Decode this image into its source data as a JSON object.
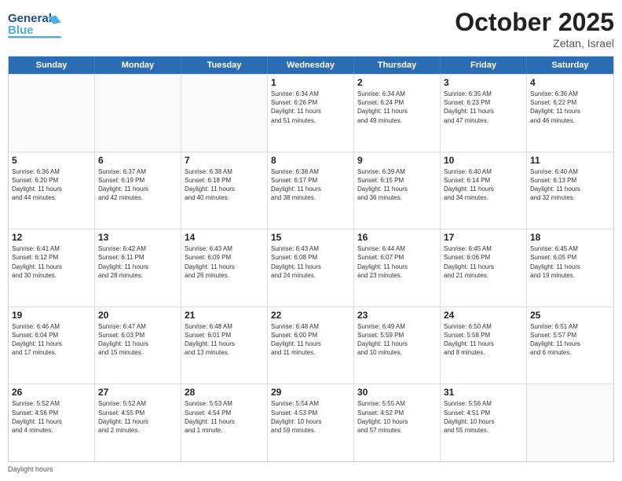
{
  "header": {
    "logo_general": "General",
    "logo_blue": "Blue",
    "month_title": "October 2025",
    "subtitle": "Zetan, Israel"
  },
  "days_of_week": [
    "Sunday",
    "Monday",
    "Tuesday",
    "Wednesday",
    "Thursday",
    "Friday",
    "Saturday"
  ],
  "footer_label": "Daylight hours",
  "weeks": [
    [
      {
        "day": "",
        "empty": true
      },
      {
        "day": "",
        "empty": true
      },
      {
        "day": "",
        "empty": true
      },
      {
        "day": "1",
        "lines": [
          "Sunrise: 6:34 AM",
          "Sunset: 6:26 PM",
          "Daylight: 11 hours",
          "and 51 minutes."
        ]
      },
      {
        "day": "2",
        "lines": [
          "Sunrise: 6:34 AM",
          "Sunset: 6:24 PM",
          "Daylight: 11 hours",
          "and 49 minutes."
        ]
      },
      {
        "day": "3",
        "lines": [
          "Sunrise: 6:35 AM",
          "Sunset: 6:23 PM",
          "Daylight: 11 hours",
          "and 47 minutes."
        ]
      },
      {
        "day": "4",
        "lines": [
          "Sunrise: 6:36 AM",
          "Sunset: 6:22 PM",
          "Daylight: 11 hours",
          "and 46 minutes."
        ]
      }
    ],
    [
      {
        "day": "5",
        "lines": [
          "Sunrise: 6:36 AM",
          "Sunset: 6:20 PM",
          "Daylight: 11 hours",
          "and 44 minutes."
        ]
      },
      {
        "day": "6",
        "lines": [
          "Sunrise: 6:37 AM",
          "Sunset: 6:19 PM",
          "Daylight: 11 hours",
          "and 42 minutes."
        ]
      },
      {
        "day": "7",
        "lines": [
          "Sunrise: 6:38 AM",
          "Sunset: 6:18 PM",
          "Daylight: 11 hours",
          "and 40 minutes."
        ]
      },
      {
        "day": "8",
        "lines": [
          "Sunrise: 6:38 AM",
          "Sunset: 6:17 PM",
          "Daylight: 11 hours",
          "and 38 minutes."
        ]
      },
      {
        "day": "9",
        "lines": [
          "Sunrise: 6:39 AM",
          "Sunset: 6:15 PM",
          "Daylight: 11 hours",
          "and 36 minutes."
        ]
      },
      {
        "day": "10",
        "lines": [
          "Sunrise: 6:40 AM",
          "Sunset: 6:14 PM",
          "Daylight: 11 hours",
          "and 34 minutes."
        ]
      },
      {
        "day": "11",
        "lines": [
          "Sunrise: 6:40 AM",
          "Sunset: 6:13 PM",
          "Daylight: 11 hours",
          "and 32 minutes."
        ]
      }
    ],
    [
      {
        "day": "12",
        "lines": [
          "Sunrise: 6:41 AM",
          "Sunset: 6:12 PM",
          "Daylight: 11 hours",
          "and 30 minutes."
        ]
      },
      {
        "day": "13",
        "lines": [
          "Sunrise: 6:42 AM",
          "Sunset: 6:11 PM",
          "Daylight: 11 hours",
          "and 28 minutes."
        ]
      },
      {
        "day": "14",
        "lines": [
          "Sunrise: 6:43 AM",
          "Sunset: 6:09 PM",
          "Daylight: 11 hours",
          "and 26 minutes."
        ]
      },
      {
        "day": "15",
        "lines": [
          "Sunrise: 6:43 AM",
          "Sunset: 6:08 PM",
          "Daylight: 11 hours",
          "and 24 minutes."
        ]
      },
      {
        "day": "16",
        "lines": [
          "Sunrise: 6:44 AM",
          "Sunset: 6:07 PM",
          "Daylight: 11 hours",
          "and 23 minutes."
        ]
      },
      {
        "day": "17",
        "lines": [
          "Sunrise: 6:45 AM",
          "Sunset: 6:06 PM",
          "Daylight: 11 hours",
          "and 21 minutes."
        ]
      },
      {
        "day": "18",
        "lines": [
          "Sunrise: 6:45 AM",
          "Sunset: 6:05 PM",
          "Daylight: 11 hours",
          "and 19 minutes."
        ]
      }
    ],
    [
      {
        "day": "19",
        "lines": [
          "Sunrise: 6:46 AM",
          "Sunset: 6:04 PM",
          "Daylight: 11 hours",
          "and 17 minutes."
        ]
      },
      {
        "day": "20",
        "lines": [
          "Sunrise: 6:47 AM",
          "Sunset: 6:03 PM",
          "Daylight: 11 hours",
          "and 15 minutes."
        ]
      },
      {
        "day": "21",
        "lines": [
          "Sunrise: 6:48 AM",
          "Sunset: 6:01 PM",
          "Daylight: 11 hours",
          "and 13 minutes."
        ]
      },
      {
        "day": "22",
        "lines": [
          "Sunrise: 6:48 AM",
          "Sunset: 6:00 PM",
          "Daylight: 11 hours",
          "and 11 minutes."
        ]
      },
      {
        "day": "23",
        "lines": [
          "Sunrise: 6:49 AM",
          "Sunset: 5:59 PM",
          "Daylight: 11 hours",
          "and 10 minutes."
        ]
      },
      {
        "day": "24",
        "lines": [
          "Sunrise: 6:50 AM",
          "Sunset: 5:58 PM",
          "Daylight: 11 hours",
          "and 8 minutes."
        ]
      },
      {
        "day": "25",
        "lines": [
          "Sunrise: 6:51 AM",
          "Sunset: 5:57 PM",
          "Daylight: 11 hours",
          "and 6 minutes."
        ]
      }
    ],
    [
      {
        "day": "26",
        "lines": [
          "Sunrise: 5:52 AM",
          "Sunset: 4:56 PM",
          "Daylight: 11 hours",
          "and 4 minutes."
        ]
      },
      {
        "day": "27",
        "lines": [
          "Sunrise: 5:52 AM",
          "Sunset: 4:55 PM",
          "Daylight: 11 hours",
          "and 2 minutes."
        ]
      },
      {
        "day": "28",
        "lines": [
          "Sunrise: 5:53 AM",
          "Sunset: 4:54 PM",
          "Daylight: 11 hours",
          "and 1 minute."
        ]
      },
      {
        "day": "29",
        "lines": [
          "Sunrise: 5:54 AM",
          "Sunset: 4:53 PM",
          "Daylight: 10 hours",
          "and 59 minutes."
        ]
      },
      {
        "day": "30",
        "lines": [
          "Sunrise: 5:55 AM",
          "Sunset: 4:52 PM",
          "Daylight: 10 hours",
          "and 57 minutes."
        ]
      },
      {
        "day": "31",
        "lines": [
          "Sunrise: 5:56 AM",
          "Sunset: 4:51 PM",
          "Daylight: 10 hours",
          "and 55 minutes."
        ]
      },
      {
        "day": "",
        "empty": true
      }
    ]
  ]
}
